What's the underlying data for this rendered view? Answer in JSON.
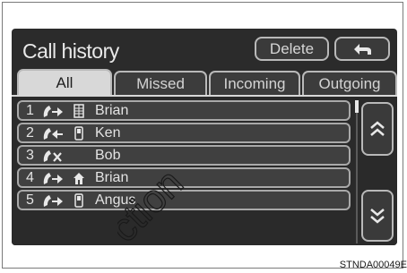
{
  "header": {
    "title": "Call history",
    "delete_label": "Delete",
    "back_icon": "return-arrow-icon"
  },
  "tabs": [
    {
      "label": "All",
      "active": true
    },
    {
      "label": "Missed",
      "active": false
    },
    {
      "label": "Incoming",
      "active": false
    },
    {
      "label": "Outgoing",
      "active": false
    }
  ],
  "calls": [
    {
      "number": "1",
      "direction_icon": "outgoing-call-icon",
      "phone_type_icon": "office-phone-icon",
      "name": "Brian"
    },
    {
      "number": "2",
      "direction_icon": "incoming-call-icon",
      "phone_type_icon": "mobile-phone-icon",
      "name": "Ken"
    },
    {
      "number": "3",
      "direction_icon": "missed-call-icon",
      "phone_type_icon": "",
      "name": "Bob"
    },
    {
      "number": "4",
      "direction_icon": "outgoing-call-icon",
      "phone_type_icon": "home-phone-icon",
      "name": "Brian"
    },
    {
      "number": "5",
      "direction_icon": "outgoing-call-icon",
      "phone_type_icon": "mobile-phone-icon",
      "name": "Angus"
    }
  ],
  "scroll": {
    "up_icon": "double-chevron-up-icon",
    "down_icon": "double-chevron-down-icon"
  },
  "watermark": "ction",
  "caption": "STNDA00049E",
  "colors": {
    "screen_bg": "#2b2b2b",
    "button_border": "#b9b9b9",
    "active_tab": "#d8d8d8",
    "text": "#e3e3e3"
  }
}
